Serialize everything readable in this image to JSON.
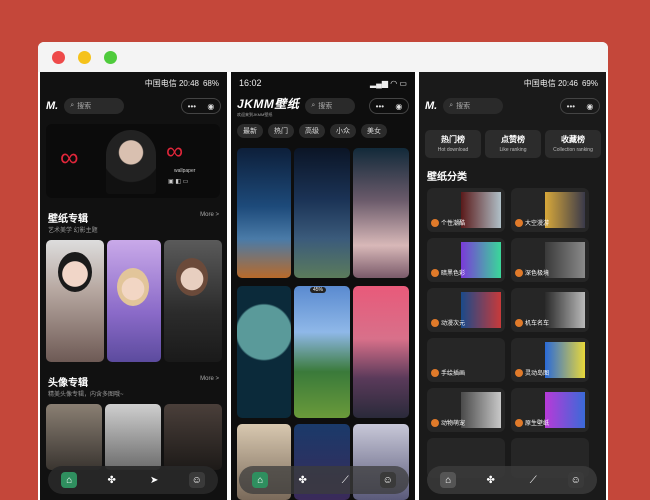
{
  "window": {
    "controls": [
      "close",
      "minimize",
      "maximize"
    ]
  },
  "phone1": {
    "status_text": "中国电信 20:48",
    "battery": "68%",
    "logo": "M.",
    "search_placeholder": "搜索",
    "banner_text": "wallpaper",
    "section1": {
      "title": "壁纸专辑",
      "subtitle": "艺术美学 幻影主题",
      "more": "More >"
    },
    "section2": {
      "title": "头像专辑",
      "subtitle": "精美头像专辑，内含多图哦~",
      "more": "More >"
    }
  },
  "phone2": {
    "status_time": "16:02",
    "logo": "JKMM壁纸",
    "logo_sub": "欢迎来到JKMM壁纸",
    "search_placeholder": "搜索",
    "tags": [
      "最新",
      "热门",
      "高级",
      "小众",
      "美女"
    ],
    "badge": "45%"
  },
  "phone3": {
    "status_text": "中国电信 20:46",
    "battery": "69%",
    "logo": "M.",
    "search_placeholder": "搜索",
    "ranks": [
      {
        "title": "热门榜",
        "sub": "Hot download"
      },
      {
        "title": "点赞榜",
        "sub": "Like ranking"
      },
      {
        "title": "收藏榜",
        "sub": "Collection ranking"
      }
    ],
    "categories_title": "壁纸分类",
    "categories": [
      "个性潮酷",
      "大空漫游",
      "暗黑色彩",
      "深色极境",
      "动漫次元",
      "机车名车",
      "手绘插画",
      "灵动岛图",
      "动物萌宠",
      "原生壁纸"
    ]
  },
  "colors": {
    "bg": "#c4473a",
    "accent": "#e07a2a",
    "nav_green": "#2f8f5f"
  }
}
